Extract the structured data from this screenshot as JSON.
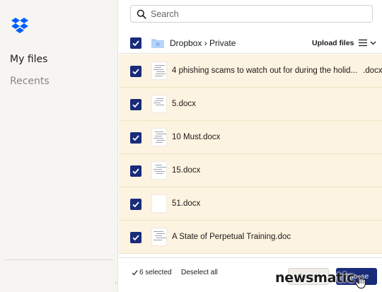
{
  "sidebar": {
    "items": [
      {
        "label": "My files"
      },
      {
        "label": "Recents"
      }
    ]
  },
  "search": {
    "placeholder": "Search",
    "value": ""
  },
  "header": {
    "breadcrumb": "Dropbox › Private",
    "upload_label": "Upload files"
  },
  "files": [
    {
      "name": "4 phishing scams to watch out for during the holid...",
      "ext": ".docx",
      "checked": true
    },
    {
      "name": "5.docx",
      "ext": "",
      "checked": true
    },
    {
      "name": "10 Must.docx",
      "ext": "",
      "checked": true
    },
    {
      "name": "15.docx",
      "ext": "",
      "checked": true
    },
    {
      "name": "51.docx",
      "ext": "",
      "checked": true
    },
    {
      "name": "A State of Perpetual Training.doc",
      "ext": "",
      "checked": true
    }
  ],
  "footer": {
    "selected_label": "6 selected",
    "deselect_label": "Deselect all",
    "cancel_label": "Cancel",
    "choose_label": "Choose"
  },
  "watermark": "newsmatic",
  "colors": {
    "accent": "#1a2b7a",
    "row_selected_bg": "#fcf3e0",
    "sidebar_bg": "#f7f5f2",
    "dropbox_blue": "#0061fe"
  }
}
